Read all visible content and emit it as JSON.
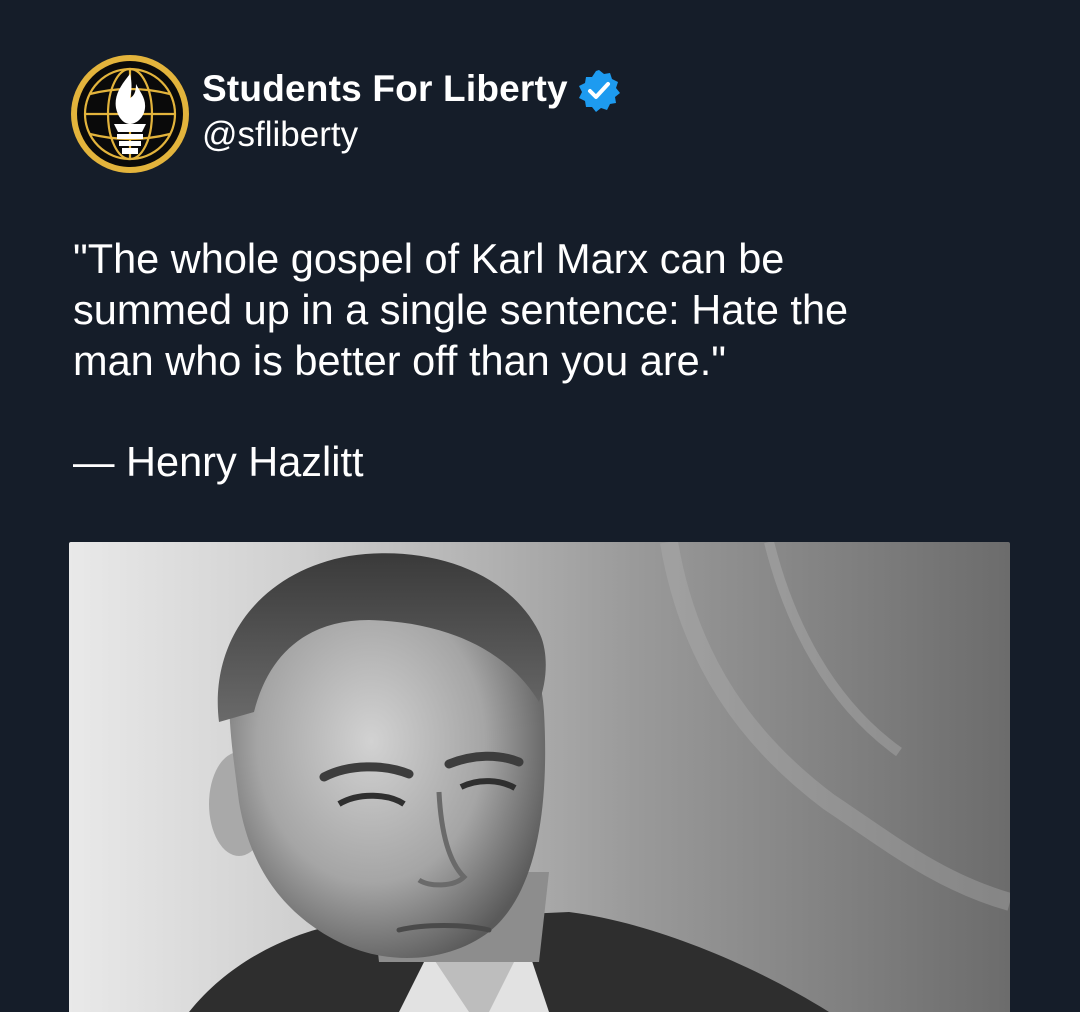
{
  "account": {
    "display_name": "Students For Liberty",
    "handle": "@sfliberty",
    "verified": true,
    "avatar_icon": "torch-globe-logo-icon",
    "verified_icon": "verified-badge-icon",
    "brand_colors": {
      "avatar_ring": "#e3b43c",
      "avatar_bg": "#0a0a0a",
      "verified": "#1d9bf0"
    }
  },
  "tweet": {
    "text": "\"The whole gospel of Karl Marx can be\nsummed up in a single sentence: Hate the\nman who is better off than you are.\"",
    "attribution": "— Henry Hazlitt"
  },
  "media": {
    "type": "photo",
    "description_icon": "portrait-photo"
  },
  "colors": {
    "background": "#151d29",
    "text": "#ffffff"
  }
}
